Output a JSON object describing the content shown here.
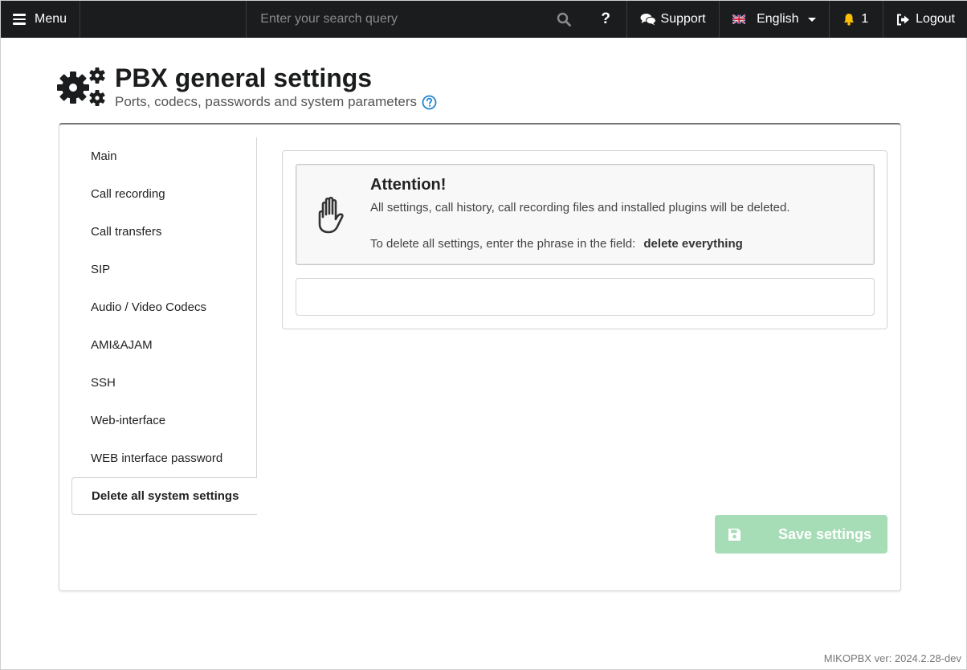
{
  "topbar": {
    "menu_label": "Menu",
    "search_placeholder": "Enter your search query",
    "help_label": "?",
    "support_label": "Support",
    "language_label": "English",
    "notifications_count": "1",
    "logout_label": "Logout"
  },
  "header": {
    "title": "PBX general settings",
    "subtitle": "Ports, codecs, passwords and system parameters"
  },
  "sidebar": {
    "items": [
      {
        "label": "Main"
      },
      {
        "label": "Call recording"
      },
      {
        "label": "Call transfers"
      },
      {
        "label": "SIP"
      },
      {
        "label": "Audio / Video Codecs"
      },
      {
        "label": "AMI&AJAM"
      },
      {
        "label": "SSH"
      },
      {
        "label": "Web-interface"
      },
      {
        "label": "WEB interface password"
      },
      {
        "label": "Delete all system settings"
      }
    ],
    "active_index": 9
  },
  "attention": {
    "title": "Attention!",
    "text": "All settings, call history, call recording files and installed plugins will be deleted.",
    "hint": "To delete all settings, enter the phrase in the field:",
    "phrase": "delete everything"
  },
  "phrase_input": {
    "value": "",
    "placeholder": ""
  },
  "save_button": {
    "label": "Save settings",
    "color": "#a6dcb6"
  },
  "footer": {
    "version": "MIKOPBX ver: 2024.2.28-dev"
  },
  "colors": {
    "topbar": "#1b1c1d",
    "accent_blue": "#2185d0",
    "bell": "#fbbd08"
  }
}
